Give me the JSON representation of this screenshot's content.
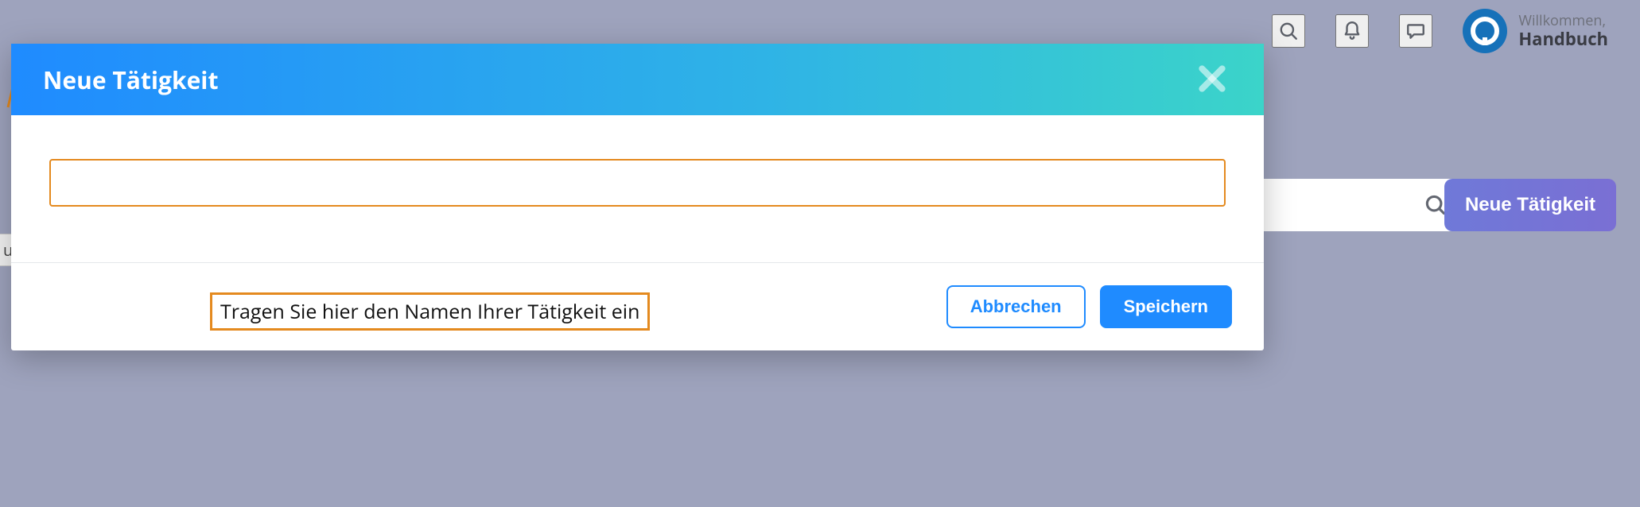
{
  "header": {
    "welcome_label": "Willkommen,",
    "username": "Handbuch",
    "icons": {
      "search": "search-icon",
      "bell": "bell-icon",
      "chat": "chat-icon"
    }
  },
  "behind": {
    "new_activity_button": "Neue Tätigkeit",
    "peek_tag_text": "ung"
  },
  "modal": {
    "title": "Neue Tätigkeit",
    "name_input_value": "",
    "cancel_label": "Abbrechen",
    "save_label": "Speichern"
  },
  "annotations": {
    "input_hint": "Tragen Sie hier den Namen Ihrer Tätigkeit ein"
  },
  "colors": {
    "accent_orange": "#e48a1f",
    "primary_blue": "#1f8bff",
    "gradient_start": "#1f8bff",
    "gradient_end": "#3bd4c9",
    "purple_button": "#6f79d8"
  }
}
